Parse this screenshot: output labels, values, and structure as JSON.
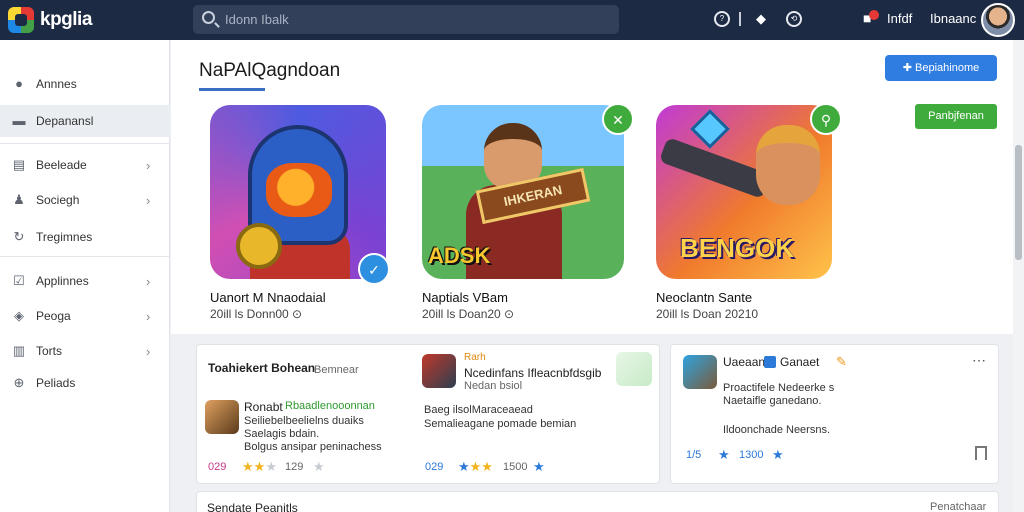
{
  "app": {
    "logo_text": "kpglia"
  },
  "search": {
    "placeholder": "Idonn Ibalk"
  },
  "topbar": {
    "icons": [
      "help-icon",
      "gamepad-icon",
      "history-icon",
      "notification-icon"
    ],
    "user_label": "Infdf",
    "user_name": "Ibnaanc"
  },
  "sidebar": {
    "items": [
      {
        "label": "Annnes",
        "icon": "circle-icon",
        "active": false,
        "chevron": false
      },
      {
        "label": "Depanansl",
        "icon": "card-icon",
        "active": true,
        "chevron": false
      },
      {
        "label": "Beeleade",
        "icon": "grid-icon",
        "active": false,
        "chevron": true
      },
      {
        "label": "Sociegh",
        "icon": "user-icon",
        "active": false,
        "chevron": true
      },
      {
        "label": "Tregimnes",
        "icon": "refresh-icon",
        "active": false,
        "chevron": false
      },
      {
        "label": "Applinnes",
        "icon": "check-box-icon",
        "active": false,
        "chevron": true
      },
      {
        "label": "Peoga",
        "icon": "tag-icon",
        "active": false,
        "chevron": true
      },
      {
        "label": "Torts",
        "icon": "chart-icon",
        "active": false,
        "chevron": true
      },
      {
        "label": "Peliads",
        "icon": "globe-icon",
        "active": false,
        "chevron": false
      }
    ]
  },
  "main": {
    "title": "NaPAlQagndoan",
    "primary_button": "✚ Bepiahinome",
    "green_button": "Panbjfenan",
    "games": [
      {
        "name": "Uanort M Nnaodaial",
        "meta": "20ill ls Donn00 ⊙"
      },
      {
        "name": "Naptials VBam",
        "meta": "20ill ls Doan20 ⊙"
      },
      {
        "name": "Neoclantn Sante",
        "meta": "20ill ls Doan 20210"
      }
    ],
    "thumb_words": {
      "game2_banner": "IHKERAN",
      "game2_word": "ADSK",
      "game3_word": "BENGOK"
    }
  },
  "reviews": [
    {
      "title": "Toahiekert Bohean",
      "subtitle": "Bemnear",
      "reviewer": "Ronabt",
      "reviewer_tag": "Rbaadlenooonnan",
      "text": [
        "Seiliebelbeelielns duaiks",
        "Saelagis bdain.",
        "Bolgus ansipar peninachess"
      ],
      "count": "029",
      "score": "129",
      "rating": 2
    },
    {
      "title": "Rarh",
      "subtitle": "Ncedinfans Ifleacnbfdsgib",
      "extra": "Nedan bsiol",
      "text": [
        "Baeg ilsolMaraceaead",
        "Semalieagane pomade bemian"
      ],
      "count": "029",
      "score": "1500",
      "rating": 3
    },
    {
      "title": "Uaeaan",
      "subtitle": "Ganaet",
      "text": [
        "Proactifele Nedeerke s",
        "Naetaifle ganedano.",
        "Ildoonchade Neersns."
      ],
      "count": "1/5",
      "score": "1300",
      "rating": 1
    }
  ],
  "bottom": {
    "label": "Sendate Peanitls",
    "right": "Penatchaar"
  },
  "colors": {
    "topbar": "#1d2a44",
    "accent": "#2f7de1",
    "green": "#3fab3c",
    "star": "#f1b41e"
  }
}
